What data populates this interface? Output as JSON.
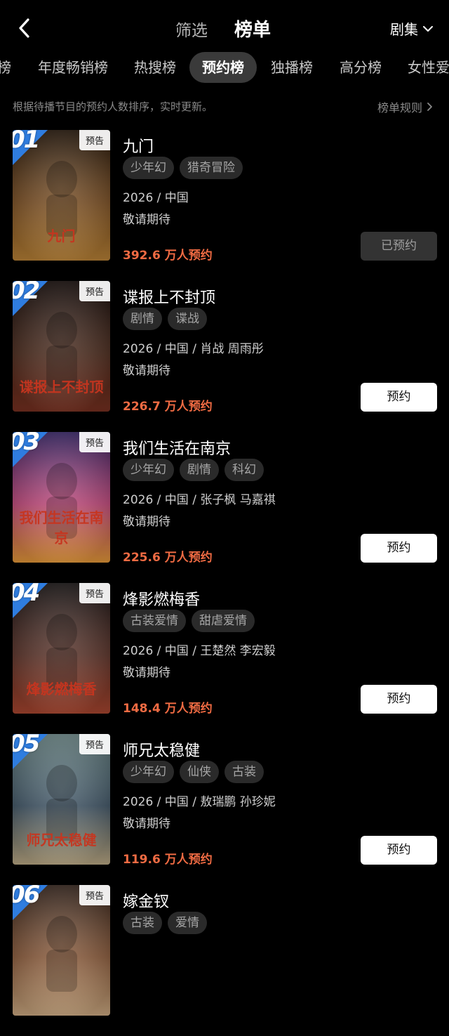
{
  "header": {
    "filter_label": "筛选",
    "title": "榜单",
    "category_label": "剧集"
  },
  "tabs": [
    {
      "label": "榜",
      "active": false
    },
    {
      "label": "年度畅销榜",
      "active": false
    },
    {
      "label": "热搜榜",
      "active": false
    },
    {
      "label": "预约榜",
      "active": true
    },
    {
      "label": "独播榜",
      "active": false
    },
    {
      "label": "高分榜",
      "active": false
    },
    {
      "label": "女性爱",
      "active": false
    }
  ],
  "info": {
    "description": "根据待播节目的预约人数排序，实时更新。",
    "rules_link": "榜单规则"
  },
  "items": [
    {
      "rank": "01",
      "badge": "预告",
      "title": "九门",
      "tags": [
        "少年幻",
        "猎奇冒险"
      ],
      "meta": "2026 / 中国",
      "status": "敬请期待",
      "count": "392.6 万人预约",
      "button": "已预约",
      "reserved": true,
      "poster_caption": "九门",
      "poster_colors": [
        "#2a1c10",
        "#7a4e22",
        "#c48a3a"
      ]
    },
    {
      "rank": "02",
      "badge": "预告",
      "title": "谍报上不封顶",
      "tags": [
        "剧情",
        "谍战"
      ],
      "meta": "2026 / 中国 / 肖战 周雨彤",
      "status": "敬请期待",
      "count": "226.7 万人预约",
      "button": "预约",
      "reserved": false,
      "poster_caption": "谍报上不封顶",
      "poster_colors": [
        "#1b1210",
        "#4a2a1c",
        "#7e3322"
      ]
    },
    {
      "rank": "03",
      "badge": "预告",
      "title": "我们生活在南京",
      "tags": [
        "少年幻",
        "剧情",
        "科幻"
      ],
      "meta": "2026 / 中国 / 张子枫 马嘉祺",
      "status": "敬请期待",
      "count": "225.6 万人预约",
      "button": "预约",
      "reserved": false,
      "poster_caption": "我们生活在南京",
      "poster_colors": [
        "#3b2a6b",
        "#c0477a",
        "#f2a23c"
      ]
    },
    {
      "rank": "04",
      "badge": "预告",
      "title": "烽影燃梅香",
      "tags": [
        "古装爱情",
        "甜虐爱情"
      ],
      "meta": "2026 / 中国 / 王楚然 李宏毅",
      "status": "敬请期待",
      "count": "148.4 万人预约",
      "button": "预约",
      "reserved": false,
      "poster_caption": "烽影燃梅香",
      "poster_colors": [
        "#1e1a1a",
        "#5a3228",
        "#b34a32"
      ]
    },
    {
      "rank": "05",
      "badge": "预告",
      "title": "师兄太稳健",
      "tags": [
        "少年幻",
        "仙侠",
        "古装"
      ],
      "meta": "2026 / 中国 / 敖瑞鹏 孙珍妮",
      "status": "敬请期待",
      "count": "119.6 万人预约",
      "button": "预约",
      "reserved": false,
      "poster_caption": "师兄太稳健",
      "poster_colors": [
        "#6f8a8a",
        "#3e5364",
        "#c7b48d"
      ]
    },
    {
      "rank": "06",
      "badge": "预告",
      "title": "嫁金钗",
      "tags": [
        "古装",
        "爱情"
      ],
      "meta": "",
      "status": "",
      "count": "",
      "button": "",
      "reserved": false,
      "poster_caption": "",
      "poster_colors": [
        "#3a2a22",
        "#8a5a3a",
        "#d9b48a"
      ]
    }
  ]
}
